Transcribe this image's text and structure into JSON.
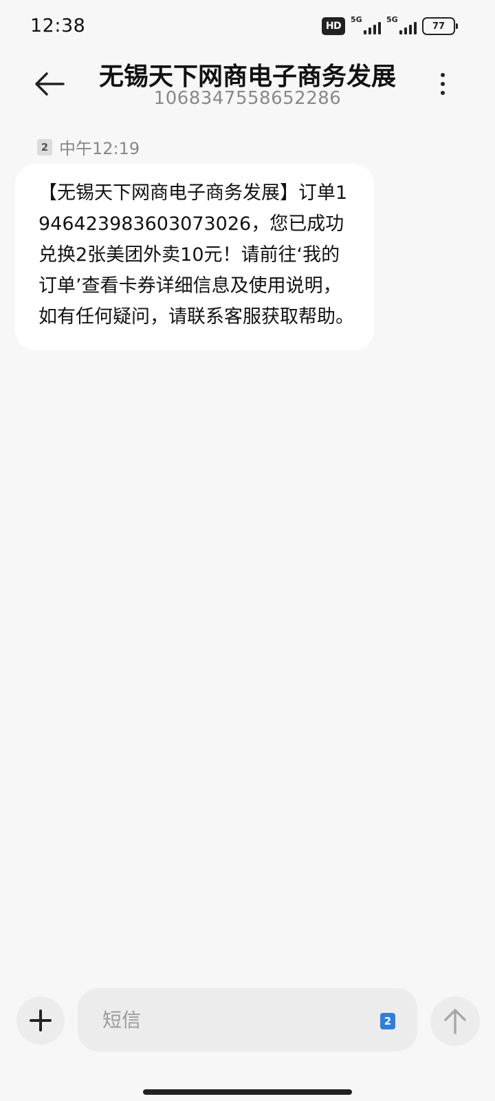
{
  "status_bar": {
    "time": "12:38",
    "hd_label": "HD",
    "sim1_network": "5G",
    "sim2_network": "5G",
    "battery": "77"
  },
  "header": {
    "title": "无锡天下网商电子商务发展",
    "number": "1068347558652286"
  },
  "message": {
    "sim_slot": "2",
    "time": "中午12:19",
    "text": "【无锡天下网商电子商务发展】订单1946423983603073026，您已成功兑换2张美团外卖10元！请前往‘我的订单’查看卡券详细信息及使用说明，如有任何疑问，请联系客服获取帮助。"
  },
  "composer": {
    "placeholder": "短信",
    "sim_slot": "2"
  },
  "icons": {
    "back": "arrow-left-icon",
    "more": "more-vertical-icon",
    "add": "plus-icon",
    "send": "arrow-up-icon"
  },
  "colors": {
    "background": "#f7f7f7",
    "bubble": "#ffffff",
    "accent_sim": "#2f7de1",
    "control_bg": "#ececec"
  }
}
